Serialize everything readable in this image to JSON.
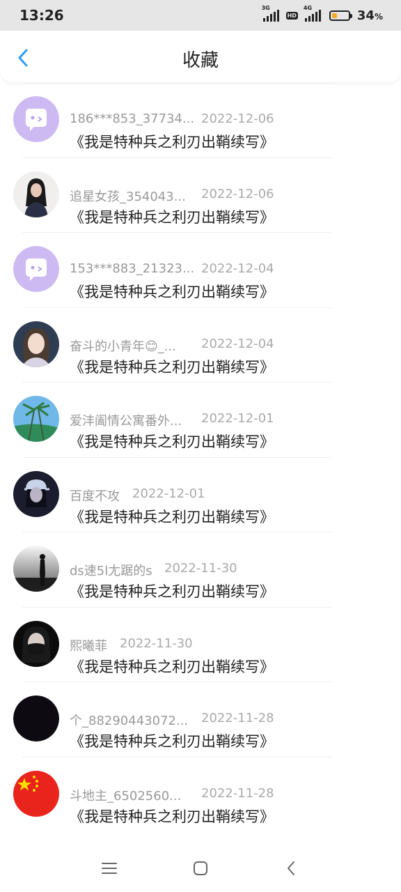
{
  "status_bar": {
    "time": "13:26",
    "net1": "3G",
    "hd": "HD",
    "net2": "4G",
    "battery_percent_value": "34",
    "battery_percent_unit": "%",
    "battery_level": 0.34
  },
  "header": {
    "title": "收藏"
  },
  "items": [
    {
      "user": "186***853_37734...",
      "date": "2022-12-06",
      "title": "《我是特种兵之利刃出鞘续写》",
      "avatar": "purple-chat-icon"
    },
    {
      "user": "追星女孩_354043...",
      "date": "2022-12-06",
      "title": "《我是特种兵之利刃出鞘续写》",
      "avatar": "girl-photo"
    },
    {
      "user": "153***883_21323...",
      "date": "2022-12-04",
      "title": "《我是特种兵之利刃出鞘续写》",
      "avatar": "purple-chat-icon"
    },
    {
      "user": "奋斗的小青年😊_...",
      "date": "2022-12-04",
      "title": "《我是特种兵之利刃出鞘续写》",
      "avatar": "anime-girl"
    },
    {
      "user": "爱沣阖情公寓番外...",
      "date": "2022-12-01",
      "title": "《我是特种兵之利刃出鞘续写》",
      "avatar": "palm-trees"
    },
    {
      "user": "百度不攻",
      "date": "2022-12-01",
      "title": "《我是特种兵之利刃出鞘续写》",
      "avatar": "cap-girl"
    },
    {
      "user": "ds速5l尢踞的s",
      "date": "2022-11-30",
      "title": "《我是特种兵之利刃出鞘续写》",
      "avatar": "silhouette"
    },
    {
      "user": "熙曦菲",
      "date": "2022-11-30",
      "title": "《我是特种兵之利刃出鞘续写》",
      "avatar": "mask-girl"
    },
    {
      "user": "个_88290443072...",
      "date": "2022-11-28",
      "title": "《我是特种兵之利刃出鞘续写》",
      "avatar": "black"
    },
    {
      "user": "斗地主_6502560...",
      "date": "2022-11-28",
      "title": "《我是特种兵之利刃出鞘续写》",
      "avatar": "china-flag"
    }
  ],
  "colors": {
    "accent": "#2d9cf5",
    "status_bg": "#e6e6e6",
    "battery": "#f4a825",
    "meta_text": "#999999"
  }
}
